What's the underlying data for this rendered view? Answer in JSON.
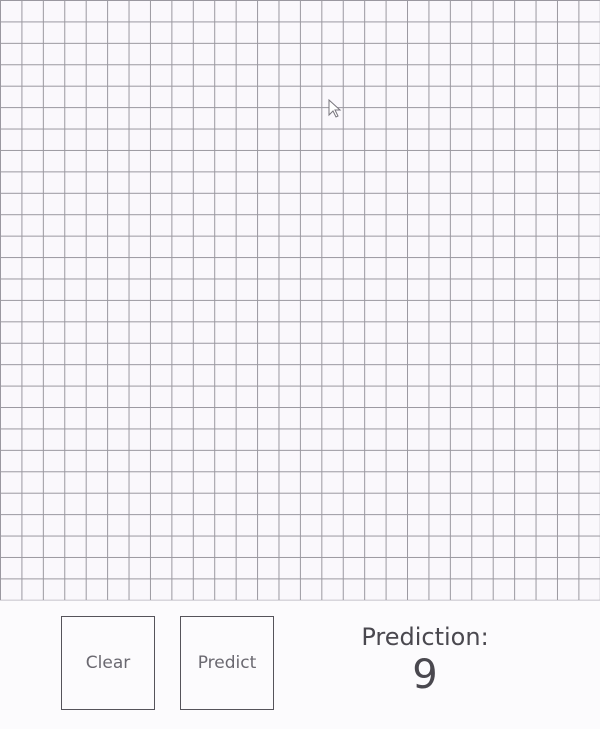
{
  "canvas": {
    "grid_cells": 28
  },
  "controls": {
    "clear_label": "Clear",
    "predict_label": "Predict"
  },
  "prediction": {
    "label": "Prediction:",
    "value": "9"
  },
  "colors": {
    "background": "#fcfbfd",
    "grid_line": "#9a98a0",
    "button_border": "#55535a",
    "text": "#4a484f"
  }
}
